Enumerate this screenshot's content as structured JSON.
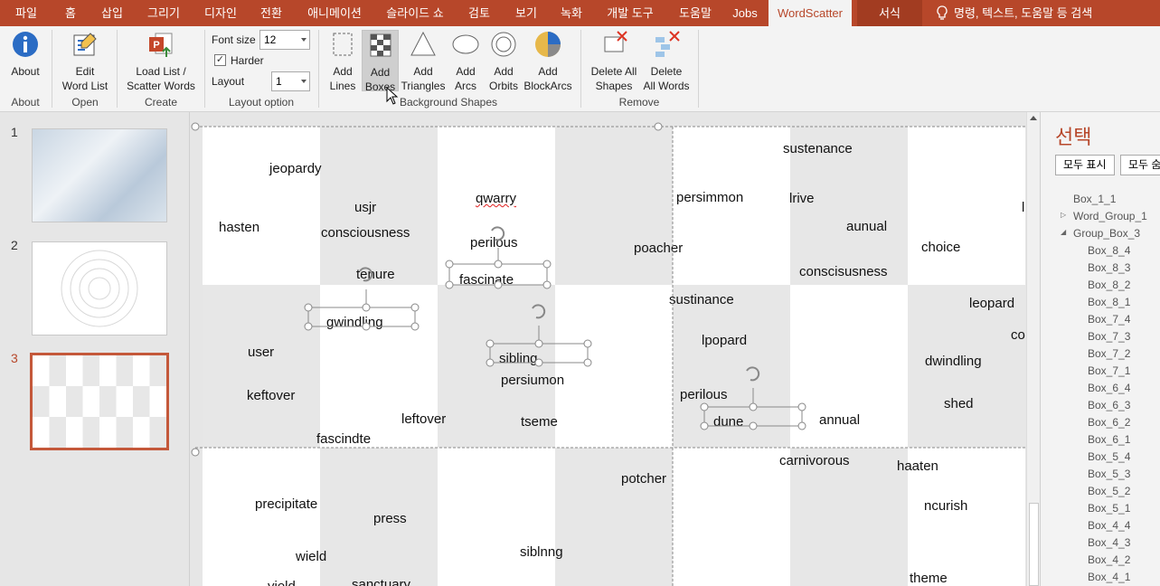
{
  "menu": {
    "tabs": [
      "파일",
      "홈",
      "삽입",
      "그리기",
      "디자인",
      "전환",
      "애니메이션",
      "슬라이드 쇼",
      "검토",
      "보기",
      "녹화",
      "개발 도구",
      "도움말",
      "Jobs",
      "WordScatter",
      "서식"
    ],
    "active_tab": "WordScatter",
    "search_text": "명령, 텍스트, 도움말 등 검색"
  },
  "ribbon": {
    "about_btn": "About",
    "about_group": "About",
    "edit_btn_line1": "Edit",
    "edit_btn_line2": "Word List",
    "open_group": "Open",
    "load_btn_line1": "Load List /",
    "load_btn_line2": "Scatter Words",
    "create_group": "Create",
    "font_size_label": "Font size",
    "font_size_value": "12",
    "harder_label": "Harder",
    "harder_checked": "✓",
    "layout_label": "Layout",
    "layout_value": "1",
    "layout_group": "Layout option",
    "add_lines_1": "Add",
    "add_lines_2": "Lines",
    "add_boxes_1": "Add",
    "add_boxes_2": "Boxes",
    "add_tri_1": "Add",
    "add_tri_2": "Triangles",
    "add_arcs_1": "Add",
    "add_arcs_2": "Arcs",
    "add_orbits_1": "Add",
    "add_orbits_2": "Orbits",
    "add_block_1": "Add",
    "add_block_2": "BlockArcs",
    "bg_group": "Background Shapes",
    "del_shapes_1": "Delete All",
    "del_shapes_2": "Shapes",
    "del_words_1": "Delete",
    "del_words_2": "All Words",
    "remove_group": "Remove"
  },
  "thumbnails": {
    "n1": "1",
    "n2": "2",
    "n3": "3"
  },
  "slide_words": [
    "jeopardy",
    "usjr",
    "hasten",
    "consciousness",
    "qwarry",
    "perilous",
    "fascinate",
    "tenure",
    "gwindling",
    "user",
    "keftover",
    "leftover",
    "fascindte",
    "sibling",
    "persiumon",
    "tseme",
    "sustenance",
    "persimmon",
    "lrive",
    "aunual",
    "poacher",
    "choice",
    "conscisusness",
    "sustinance",
    "leopard",
    "lpopard",
    "co",
    "dwindling",
    "perilous",
    "shed",
    "dune",
    "annual",
    "carnivorous",
    "haaten",
    "potcher",
    "precipitate",
    "press",
    "ncurish",
    "wield",
    "siblnng",
    "theme",
    "sanctuary",
    "yield",
    "l"
  ],
  "selection_pane": {
    "title": "선택",
    "show_all": "모두 표시",
    "hide_all": "모두 숨",
    "items": [
      "Box_1_1",
      "Word_Group_1",
      "Group_Box_3",
      "Box_8_4",
      "Box_8_3",
      "Box_8_2",
      "Box_8_1",
      "Box_7_4",
      "Box_7_3",
      "Box_7_2",
      "Box_7_1",
      "Box_6_4",
      "Box_6_3",
      "Box_6_2",
      "Box_6_1",
      "Box_5_4",
      "Box_5_3",
      "Box_5_2",
      "Box_5_1",
      "Box_4_4",
      "Box_4_3",
      "Box_4_2",
      "Box_4_1"
    ]
  },
  "colors": {
    "accent": "#b7472a",
    "cell_gray": "#e7e7e7"
  }
}
